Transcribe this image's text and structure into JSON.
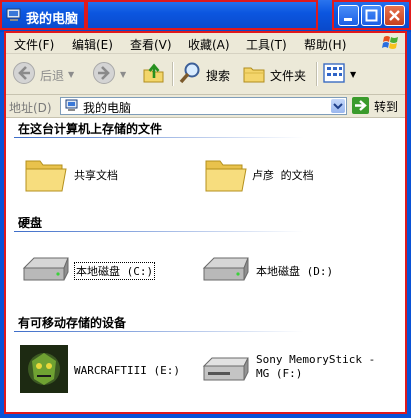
{
  "window": {
    "title": "我的电脑",
    "controls": {
      "minimize": "_",
      "maximize": "□",
      "close": "✕"
    }
  },
  "menubar": {
    "items": [
      "文件(F)",
      "编辑(E)",
      "查看(V)",
      "收藏(A)",
      "工具(T)",
      "帮助(H)"
    ]
  },
  "toolbar": {
    "back": "后退",
    "search": "搜索",
    "folders": "文件夹"
  },
  "address": {
    "label": "地址(D)",
    "value": "我的电脑",
    "go": "转到"
  },
  "groups": [
    {
      "title": "在这台计算机上存储的文件",
      "items": [
        {
          "label": "共享文档",
          "icon": "folder-icon"
        },
        {
          "label": "卢彦 的文档",
          "icon": "folder-icon"
        }
      ]
    },
    {
      "title": "硬盘",
      "items": [
        {
          "label": "本地磁盘 (C:)",
          "icon": "hard-drive-icon"
        },
        {
          "label": "本地磁盘 (D:)",
          "icon": "hard-drive-icon"
        }
      ]
    },
    {
      "title": "有可移动存储的设备",
      "items": [
        {
          "label": "WARCRAFTIII (E:)",
          "icon": "cd-drive-icon"
        },
        {
          "label_line1": "Sony MemoryStick -",
          "label_line2": "MG (F:)",
          "icon": "removable-drive-icon"
        }
      ]
    }
  ],
  "colors": {
    "titlebar": "#0b56e0",
    "highlight_frame": "#e0191c",
    "menubar": "#ece9d8"
  }
}
